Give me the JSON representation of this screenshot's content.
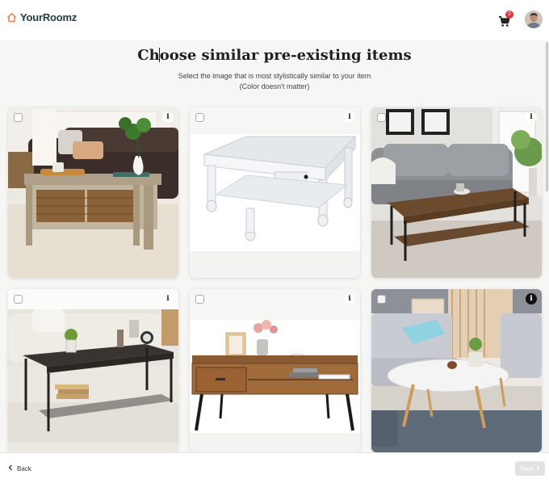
{
  "app": {
    "name": "YourRoomz"
  },
  "header": {
    "cart_count": "0"
  },
  "page": {
    "title": "Choose similar pre-existing items",
    "subtitle_line1": "Select the image that is most stylistically similar to your item",
    "subtitle_line2": "(Color doesn't matter)"
  },
  "items": [
    {
      "name": "Rustic wood coffee table with wicker baskets",
      "selected": false,
      "info": "i"
    },
    {
      "name": "White square coffee table with drawer",
      "selected": false,
      "info": "i"
    },
    {
      "name": "Walnut and metal industrial coffee table",
      "selected": false,
      "info": "i"
    },
    {
      "name": "Dark wood coffee table with metal mesh shelf",
      "selected": false,
      "info": "i"
    },
    {
      "name": "Rustic brown coffee table with drawer and shelf",
      "selected": false,
      "info": "i"
    },
    {
      "name": "White oval coffee table with wooden legs",
      "selected": false,
      "info": "i"
    }
  ],
  "footer": {
    "back_label": "Back",
    "next_label": "Next"
  },
  "colors": {
    "brand": "#1f3b40",
    "accent": "#e8834a",
    "badge": "#e0333a",
    "next_disabled": "#e2e2e2"
  }
}
